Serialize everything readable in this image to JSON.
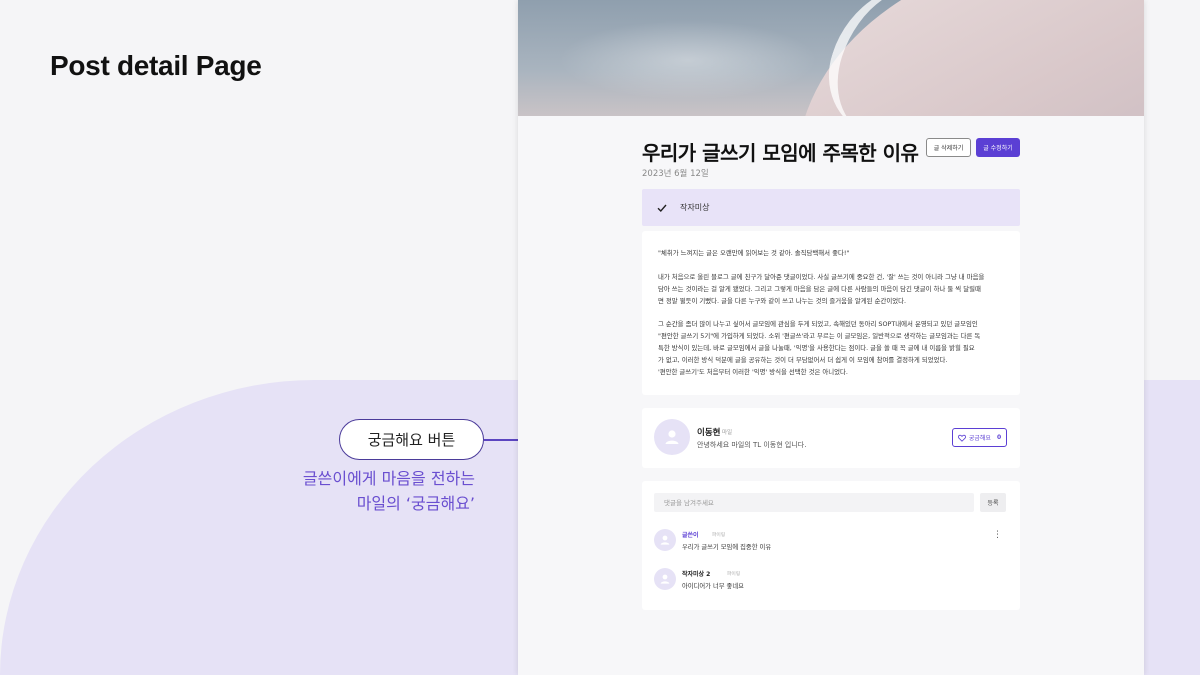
{
  "slide": {
    "title": "Post detail Page",
    "callout_label": "궁금해요 버튼",
    "callout_desc_line1": "글쓴이에게 마음을 전하는",
    "callout_desc_line2": "마일의 ‘궁금해요’"
  },
  "post": {
    "title": "우리가 글쓰기 모임에 주목한 이유",
    "date": "2023년 6월 12일",
    "delete_label": "글 삭제하기",
    "edit_label": "글 수정하기",
    "tag": "작자미상",
    "paragraphs": [
      "\"체취가 느껴지는 글은 오랜만에 읽어보는 것 같아. 솔직담백해서 좋다!\"",
      "내가 처음으로 올린 블로그 글에 친구가 달아준 댓글이었다. 사실 글쓰기에 중요한 건, '잘' 쓰는 것이 아니라 그냥 내 마음을\n담아 쓰는 것이라는 걸 알게 됐었다. 그리고 그렇게 마음을 담은 글에 다른 사람들의 마음이 담긴 댓글이 하나 둘 씩 달릴때\n면 정말 뛸듯이 기뻤다. 글을 다른 누구와 같이 쓰고 나누는 것의 즐거움을 알게된 순간이었다.",
      "그 순간을 좀더 많이 나누고 싶어서 글모임에 관심을 두게 되었고, 속해있던 동아리 SOPT내에서 운영되고 있던 글모임인\n\"편안한 글쓰기 5기\"에 가입하게 되었다. 소위 '편글쓰'라고 부르는 이 글모임은, 일반적으로 생각하는 글모임과는 다른 독\n특한 방식이 있는데, 바로 글모임에서 글을 나눌때, '익명'을 사용한다는 점이다. 글을 쓸 때 꼭 글에 내 이름을 밝힐 필요\n가 없고, 이러한 방식 덕분에 글을 공유하는 것이 더 부담없어서 더 쉽게 이 모임에 참여를 결정하게 되었었다.\n'편안한 글쓰기'도 처음부터 이러한 '익명' 방식을 선택한 것은 아니었다."
    ]
  },
  "author": {
    "name": "이동현",
    "role": "마일",
    "intro": "안녕하세요 마일의 TL 이동현 입니다.",
    "like_label": "궁금해요",
    "like_count": "0"
  },
  "comments": {
    "placeholder": "댓글을 남겨주세요",
    "submit_label": "등록",
    "items": [
      {
        "author": "글쓴이",
        "role": "파이팅",
        "text": "우리가 글쓰기 모임에 집중한 이유"
      },
      {
        "author": "작자미상 2",
        "role": "파이팅",
        "text": "아이디어가 너무 좋네요"
      }
    ]
  },
  "colors": {
    "accent": "#5b3fd4",
    "tag_bg": "#e8e3f8",
    "callout_text": "#6a4fd0"
  }
}
